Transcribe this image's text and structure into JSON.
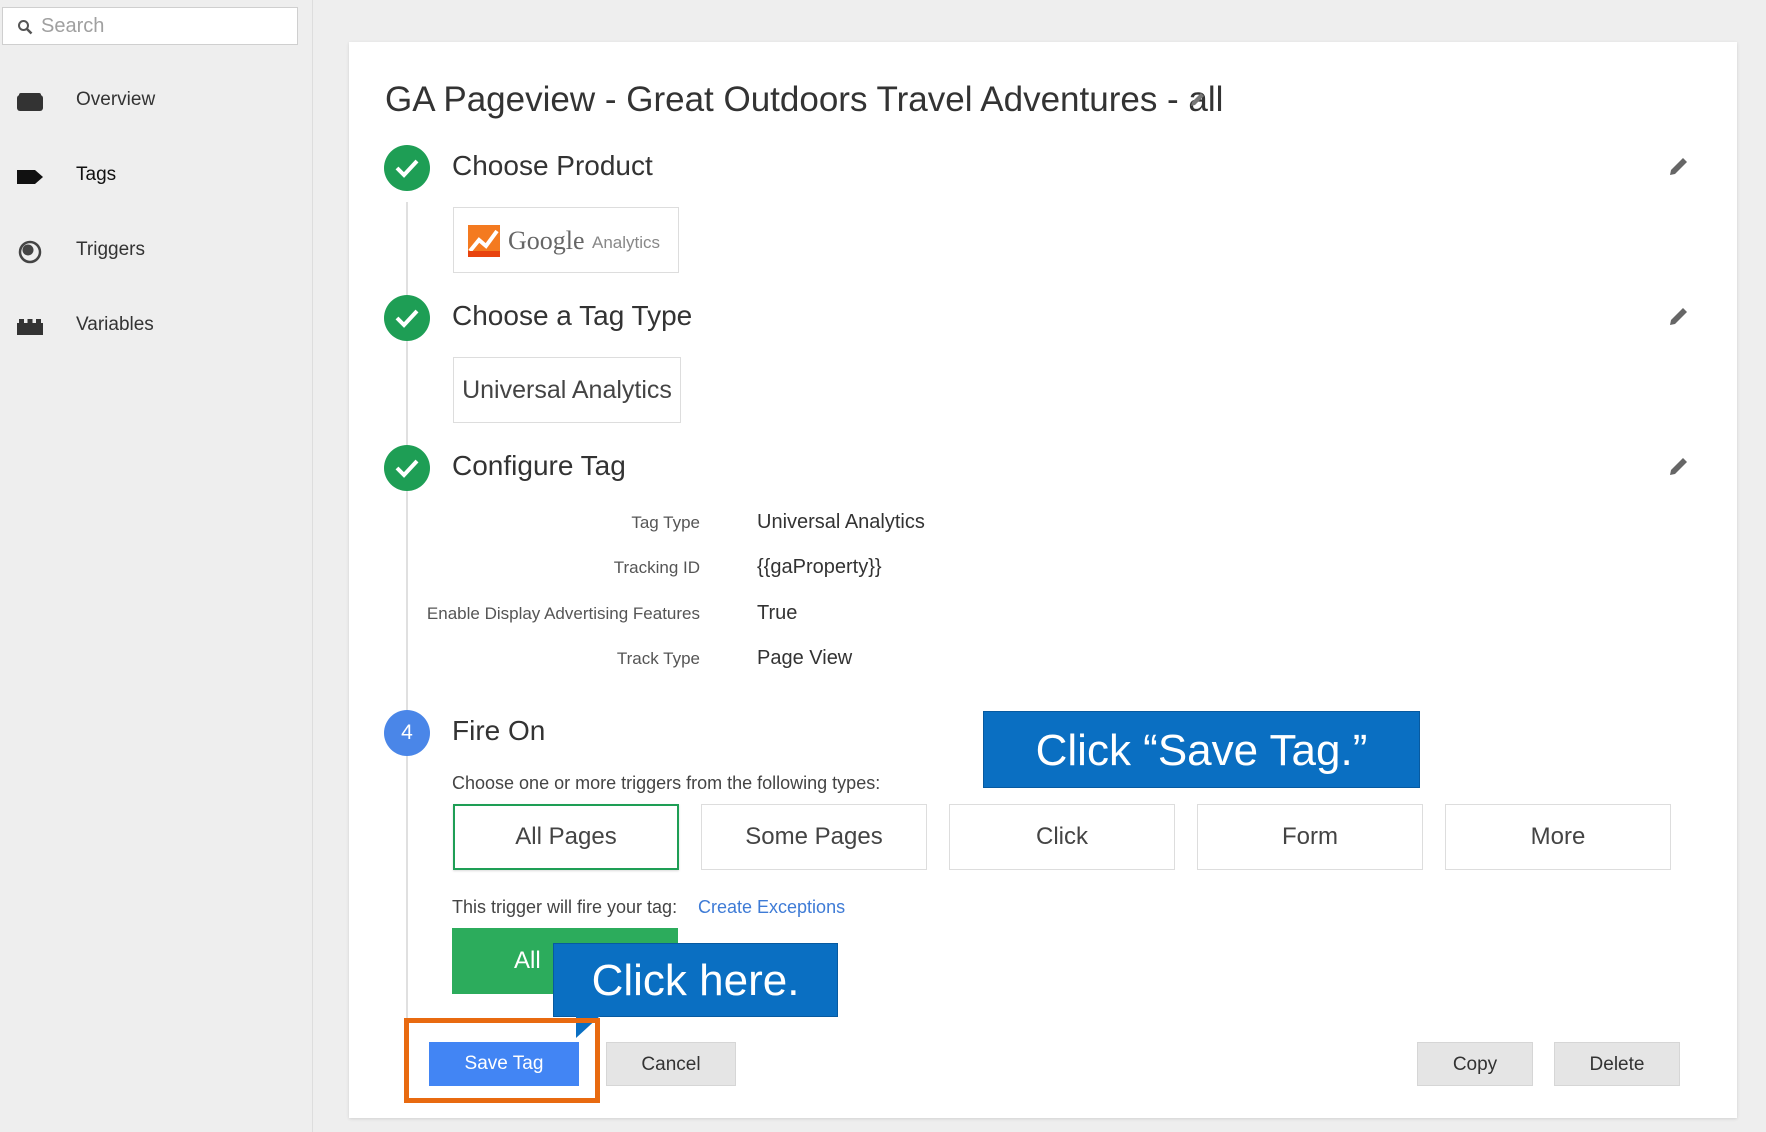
{
  "sidebar": {
    "search_placeholder": "Search",
    "items": [
      {
        "label": "Overview",
        "icon": "folder-icon"
      },
      {
        "label": "Tags",
        "icon": "tag-icon"
      },
      {
        "label": "Triggers",
        "icon": "trigger-icon"
      },
      {
        "label": "Variables",
        "icon": "variables-icon"
      }
    ]
  },
  "tag": {
    "title": "GA Pageview - Great Outdoors Travel Adventures - all",
    "steps": {
      "product": {
        "title": "Choose Product",
        "brand_name": "Google",
        "brand_sub": "Analytics"
      },
      "tag_type": {
        "title": "Choose a Tag Type",
        "value": "Universal Analytics"
      },
      "configure": {
        "title": "Configure Tag",
        "rows": [
          {
            "key": "Tag Type",
            "value": "Universal Analytics"
          },
          {
            "key": "Tracking ID",
            "value": "{{gaProperty}}"
          },
          {
            "key": "Enable Display Advertising Features",
            "value": "True"
          },
          {
            "key": "Track Type",
            "value": "Page View"
          }
        ]
      },
      "fire_on": {
        "number": "4",
        "title": "Fire On",
        "hint": "Choose one or more triggers from the following types:",
        "triggers": [
          "All Pages",
          "Some Pages",
          "Click",
          "Form",
          "More"
        ],
        "fire_text": "This trigger will fire your tag:",
        "exceptions_link": "Create Exceptions",
        "chip_partial": "All"
      }
    }
  },
  "actions": {
    "save": "Save Tag",
    "cancel": "Cancel",
    "copy": "Copy",
    "delete": "Delete"
  },
  "callouts": {
    "save_tag": "Click “Save Tag.”",
    "click_here": "Click here."
  },
  "colors": {
    "accent_blue": "#4285f4",
    "success_green": "#1e9e55",
    "callout_blue": "#0a6fc2",
    "highlight_orange": "#e86a10"
  }
}
